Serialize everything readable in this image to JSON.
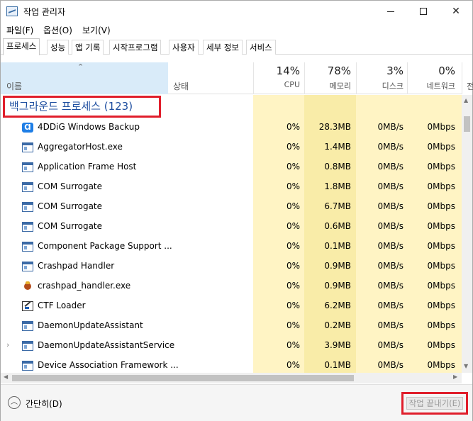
{
  "window": {
    "title": "작업 관리자",
    "icon": "task-manager-icon"
  },
  "menu": [
    "파일(F)",
    "옵션(O)",
    "보기(V)"
  ],
  "tabs": [
    "프로세스",
    "성능",
    "앱 기록",
    "시작프로그램",
    "사용자",
    "세부 정보",
    "서비스"
  ],
  "columns": {
    "name": "이름",
    "status": "상태",
    "cpu": {
      "percent": "14%",
      "label": "CPU"
    },
    "memory": {
      "percent": "78%",
      "label": "메모리"
    },
    "disk": {
      "percent": "3%",
      "label": "디스크"
    },
    "network": {
      "percent": "0%",
      "label": "네트워크"
    },
    "power_partial": "전"
  },
  "group": {
    "title": "백그라운드 프로세스 (123)"
  },
  "processes": [
    {
      "name": "4DDiG Windows Backup",
      "cpu": "0%",
      "memory": "28.3MB",
      "disk": "0MB/s",
      "network": "0Mbps",
      "icon": "4ddig-icon"
    },
    {
      "name": "AggregatorHost.exe",
      "cpu": "0%",
      "memory": "1.4MB",
      "disk": "0MB/s",
      "network": "0Mbps",
      "icon": "window-app-icon"
    },
    {
      "name": "Application Frame Host",
      "cpu": "0%",
      "memory": "0.8MB",
      "disk": "0MB/s",
      "network": "0Mbps",
      "icon": "window-app-icon"
    },
    {
      "name": "COM Surrogate",
      "cpu": "0%",
      "memory": "1.8MB",
      "disk": "0MB/s",
      "network": "0Mbps",
      "icon": "window-app-icon"
    },
    {
      "name": "COM Surrogate",
      "cpu": "0%",
      "memory": "6.7MB",
      "disk": "0MB/s",
      "network": "0Mbps",
      "icon": "window-app-icon"
    },
    {
      "name": "COM Surrogate",
      "cpu": "0%",
      "memory": "0.6MB",
      "disk": "0MB/s",
      "network": "0Mbps",
      "icon": "window-app-icon"
    },
    {
      "name": "Component Package Support ...",
      "cpu": "0%",
      "memory": "0.1MB",
      "disk": "0MB/s",
      "network": "0Mbps",
      "icon": "window-app-icon"
    },
    {
      "name": "Crashpad Handler",
      "cpu": "0%",
      "memory": "0.9MB",
      "disk": "0MB/s",
      "network": "0Mbps",
      "icon": "window-app-icon"
    },
    {
      "name": "crashpad_handler.exe",
      "cpu": "0%",
      "memory": "0.9MB",
      "disk": "0MB/s",
      "network": "0Mbps",
      "icon": "bug-icon"
    },
    {
      "name": "CTF Loader",
      "cpu": "0%",
      "memory": "6.2MB",
      "disk": "0MB/s",
      "network": "0Mbps",
      "icon": "ctf-loader-icon"
    },
    {
      "name": "DaemonUpdateAssistant",
      "cpu": "0%",
      "memory": "0.2MB",
      "disk": "0MB/s",
      "network": "0Mbps",
      "icon": "window-app-icon"
    },
    {
      "name": "DaemonUpdateAssistantService",
      "cpu": "0%",
      "memory": "3.9MB",
      "disk": "0MB/s",
      "network": "0Mbps",
      "icon": "window-app-icon",
      "expandable": true
    },
    {
      "name": "Device Association Framework ...",
      "cpu": "0%",
      "memory": "0.1MB",
      "disk": "0MB/s",
      "network": "0Mbps",
      "icon": "window-app-icon"
    }
  ],
  "footer": {
    "less_details": "간단히(D)",
    "end_task": "작업 끝내기(E)"
  },
  "colors": {
    "group_title": "#1f4fa0",
    "highlight": "#e01e2b",
    "heat_light": "#fff4c4",
    "heat_memory": "#f9eca8",
    "name_header_selected": "#d9ebf9"
  }
}
